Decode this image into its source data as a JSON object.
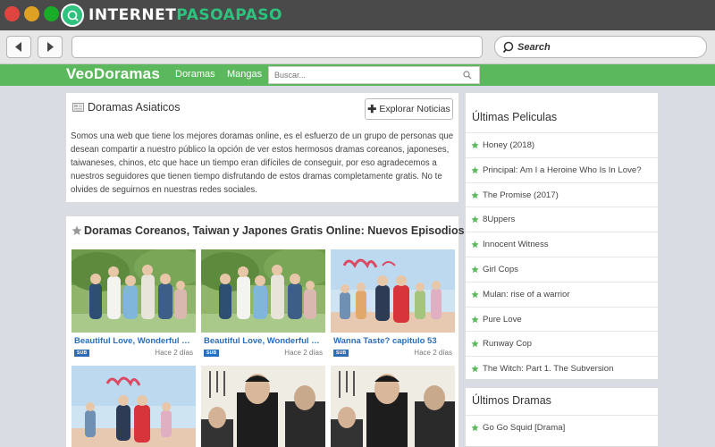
{
  "browser": {
    "brand_primary": "INTERNET",
    "brand_accent": "PASOAPASO",
    "search_placeholder": "Search",
    "url": ""
  },
  "site": {
    "logo": "VeoDoramas",
    "nav": [
      "Doramas",
      "Mangas"
    ],
    "search_placeholder": "Buscar..."
  },
  "intro": {
    "title": "Doramas Asiaticos",
    "button_label": "Explorar Noticias",
    "description": "Somos una web que tiene los mejores doramas online, es el esfuerzo de un grupo de personas que desean compartir a nuestro público la opción de ver estos hermosos dramas coreanos, japoneses, taiwaneses, chinos, etc que hace un tiempo eran difíciles de conseguir, por eso agradecemos a nuestros seguidores que tienen tiempo disfrutando de estos dramas completamente gratis. No te olvides de seguirnos en nuestras redes sociales."
  },
  "episodes": {
    "title": "Doramas Coreanos, Taiwan y Japones Gratis Online: Nuevos Episodios",
    "cards": [
      {
        "title": "Beautiful Love, Wonderful Life ...",
        "badge": "SUB",
        "time": "Hace 2 días"
      },
      {
        "title": "Beautiful Love, Wonderful Life ...",
        "badge": "SUB",
        "time": "Hace 2 días"
      },
      {
        "title": "Wanna Taste? capitulo 53",
        "badge": "SUB",
        "time": "Hace 2 días"
      }
    ]
  },
  "sidebar": {
    "movies_title": "Últimas Peliculas",
    "movies": [
      "Honey (2018)",
      "Principal: Am I a Heroine Who Is In Love?",
      "The Promise (2017)",
      "8Uppers",
      "Innocent Witness",
      "Girl Cops",
      "Mulan: rise of a warrior",
      "Pure Love",
      "Runway Cop",
      "The Witch: Part 1. The Subversion"
    ],
    "dramas_title": "Últimos Dramas",
    "dramas": [
      "Go Go Squid [Drama]"
    ]
  },
  "colors": {
    "site_green": "#5cb85c",
    "link_blue": "#2a6ebb",
    "star_green": "#5cb85c"
  }
}
